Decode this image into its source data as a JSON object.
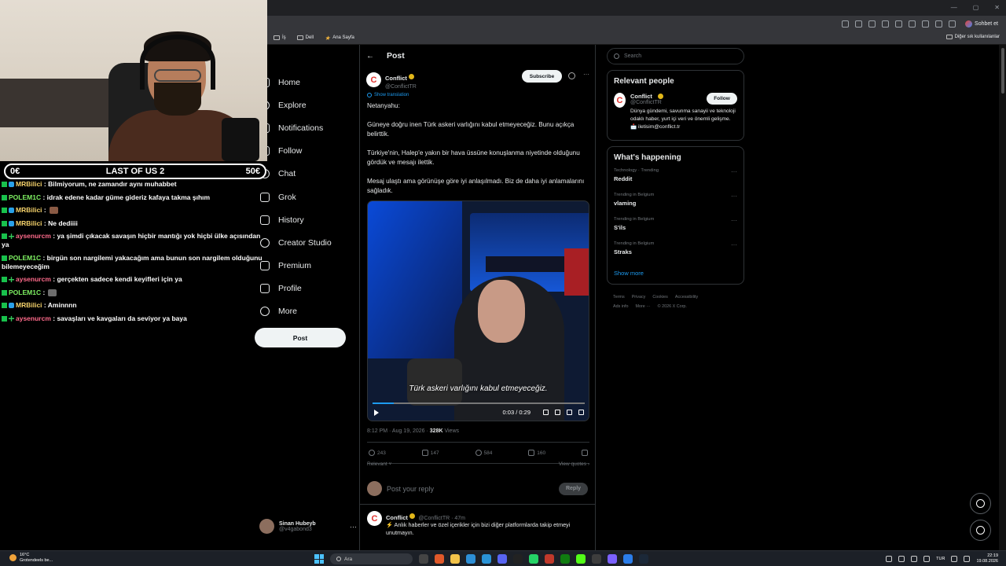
{
  "taskbar_weather": {
    "temp": "16°C",
    "desc": "Grotendeels be..."
  },
  "browser": {
    "chat_button": "Sohbet et",
    "bookmarks": [
      {
        "label": "İş",
        "icon": "folder-icon"
      },
      {
        "label": "Dell",
        "icon": "folder-icon"
      },
      {
        "label": "Ana Sayfa",
        "icon": "star-icon"
      }
    ],
    "bookmarks_other": "Diğer sık kullanılanlar"
  },
  "overlay": {
    "left_value": "0€",
    "game_title": "LAST OF US 2",
    "right_value": "50€",
    "chat": [
      {
        "user": "MRBilici",
        "color": "#f6d36b",
        "badges": [
          "b1",
          "b2"
        ],
        "text": ": Bilmiyorum, ne zamandır aynı muhabbet"
      },
      {
        "user": "POLEM1C",
        "color": "#7ef062",
        "badges": [
          "b1"
        ],
        "text": ": idrak edene kadar güme gideriz kafaya takma şıhım"
      },
      {
        "user": "MRBilici",
        "color": "#f6d36b",
        "badges": [
          "b1",
          "b2"
        ],
        "text": ":",
        "emote": "emo"
      },
      {
        "user": "MRBilici",
        "color": "#f6d36b",
        "badges": [
          "b1",
          "b2"
        ],
        "text": ": Ne dediiii"
      },
      {
        "user": "aysenurcm",
        "color": "#ff6b8b",
        "badges": [
          "b1",
          "b3"
        ],
        "text": ": ya şimdi çıkacak savaşın hiçbir mantığı yok hiçbi ülke açısından ya"
      },
      {
        "user": "POLEM1C",
        "color": "#7ef062",
        "badges": [
          "b1"
        ],
        "text": ": birgün son nargilemi yakacağım ama bunun son nargilem olduğunu bilemeyeceğim"
      },
      {
        "user": "aysenurcm",
        "color": "#ff6b8b",
        "badges": [
          "b1",
          "b3"
        ],
        "text": ": gerçekten sadece kendi keyifleri için ya"
      },
      {
        "user": "POLEM1C",
        "color": "#7ef062",
        "badges": [
          "b1"
        ],
        "text": ":",
        "emote": "emo2"
      },
      {
        "user": "MRBilici",
        "color": "#f6d36b",
        "badges": [
          "b1",
          "b2"
        ],
        "text": ": Aminnnn"
      },
      {
        "user": "aysenurcm",
        "color": "#ff6b8b",
        "badges": [
          "b1",
          "b3"
        ],
        "text": ": savaşları ve kavgaları da seviyor ya baya"
      }
    ]
  },
  "nav": {
    "items": [
      {
        "label": "Home",
        "icon": "home-icon"
      },
      {
        "label": "Explore",
        "icon": "explore-icon"
      },
      {
        "label": "Notifications",
        "icon": "bell-icon"
      },
      {
        "label": "Follow",
        "icon": "follow-icon"
      },
      {
        "label": "Chat",
        "icon": "chat-icon"
      },
      {
        "label": "Grok",
        "icon": "grok-icon"
      },
      {
        "label": "History",
        "icon": "bookmark-icon"
      },
      {
        "label": "Creator Studio",
        "icon": "creator-icon"
      },
      {
        "label": "Premium",
        "icon": "premium-icon"
      },
      {
        "label": "Profile",
        "icon": "profile-icon"
      },
      {
        "label": "More",
        "icon": "more-icon"
      }
    ],
    "post_button": "Post",
    "account": {
      "name": "Sinan Hubeyb",
      "handle": "@v4gabond3"
    }
  },
  "post": {
    "header": "Post",
    "author": {
      "name": "Conflict",
      "handle": "@ConflictTR",
      "logo": "C"
    },
    "subscribe": "Subscribe",
    "show_translation": "Show translation",
    "paragraphs": [
      "Netanyahu:",
      "Güneye doğru inen Türk askeri varlığını kabul etmeyeceğiz. Bunu açıkça belirttik.",
      "Türkiye'nin, Halep'e yakın bir hava üssüne konuşlanma niyetinde olduğunu gördük ve mesajı ilettik.",
      "Mesaj ulaştı ama görünüşe göre iyi anlaşılmadı. Biz de daha iyi anlamalarını sağladık."
    ],
    "video": {
      "subtitle": "Türk askeri varlığını kabul etmeyeceğiz.",
      "time": "0:03 / 0:29",
      "progress": 0.1
    },
    "meta": {
      "time": "8:12 PM · Aug 19, 2026 · ",
      "views": "328K",
      "views_label": " Views"
    },
    "stats": {
      "replies": "243",
      "reposts": "147",
      "likes": "584",
      "bookmarks": "160"
    },
    "sort": "Relevant",
    "view_quotes": "View quotes",
    "reply_placeholder": "Post your reply",
    "reply_button": "Reply",
    "reply2": {
      "name": "Conflict",
      "handle": "@ConflictTR · 47m",
      "text": "⚡ Anlık haberler ve özel içerikler için bizi diğer platformlarda takip etmeyi unutmayın."
    }
  },
  "right": {
    "search_placeholder": "Search",
    "relevant_title": "Relevant people",
    "person": {
      "name": "Conflict",
      "handle": "@ConflictTR",
      "follow": "Follow",
      "bio": "Dünya gündemi, savunma sanayii ve teknoloji odaklı haber, yurt içi veri ve önemli gelişme. 📩 iletisim@conflict.tr"
    },
    "happening_title": "What's happening",
    "trends": [
      {
        "cat": "Technology · Trending",
        "title": "Reddit"
      },
      {
        "cat": "Trending in Belgium",
        "title": "vlaming"
      },
      {
        "cat": "Trending in Belgium",
        "title": "S'ils"
      },
      {
        "cat": "Trending in Belgium",
        "title": "Straks"
      }
    ],
    "show_more": "Show more",
    "footer": [
      "Terms",
      "Privacy",
      "Cookies",
      "Accessibility",
      "Ads info",
      "More ···",
      "© 2026 X Corp."
    ]
  },
  "taskbar": {
    "search": "Ara",
    "lang": "TUR",
    "time": "22:19",
    "date": "19.08.2026"
  }
}
